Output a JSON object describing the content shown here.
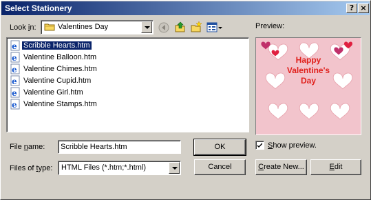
{
  "window": {
    "title": "Select Stationery",
    "help_label": "?",
    "close_label": "×"
  },
  "look_in": {
    "label_pre": "Look ",
    "label_accel": "i",
    "label_post": "n:",
    "value": "Valentines Day"
  },
  "files": [
    {
      "name": "Scribble Hearts.htm",
      "selected": true
    },
    {
      "name": "Valentine Balloon.htm",
      "selected": false
    },
    {
      "name": "Valentine Chimes.htm",
      "selected": false
    },
    {
      "name": "Valentine Cupid.htm",
      "selected": false
    },
    {
      "name": "Valentine Girl.htm",
      "selected": false
    },
    {
      "name": "Valentine Stamps.htm",
      "selected": false
    }
  ],
  "file_name": {
    "label_pre": "File ",
    "label_accel": "n",
    "label_post": "ame:",
    "value": "Scribble Hearts.htm"
  },
  "file_type": {
    "label_pre": "Files of ",
    "label_accel": "t",
    "label_post": "ype:",
    "value": "HTML Files (*.htm;*.html)"
  },
  "buttons": {
    "ok": "OK",
    "cancel": "Cancel",
    "create_new_pre": "",
    "create_new_accel": "C",
    "create_new_post": "reate New...",
    "edit_accel": "E",
    "edit_post": "dit"
  },
  "preview": {
    "label": "Preview:",
    "line1": "Happy",
    "line2": "Valentine's",
    "line3": "Day",
    "text_color": "#e0201c",
    "bg_color": "#f2c4cc"
  },
  "show_preview": {
    "checked": true,
    "label_accel": "S",
    "label_post": "how preview."
  },
  "colors": {
    "titlebar_start": "#0a246a",
    "titlebar_end": "#a6caf0",
    "face": "#d4d0c8",
    "selection": "#0a246a"
  }
}
